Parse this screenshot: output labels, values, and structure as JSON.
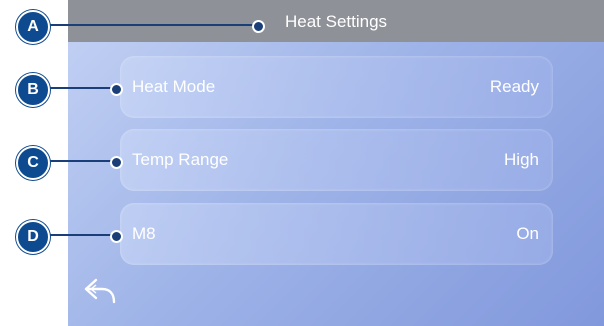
{
  "screen": {
    "title": "Heat Settings",
    "rows": [
      {
        "label": "Heat Mode",
        "value": "Ready"
      },
      {
        "label": "Temp Range",
        "value": "High"
      },
      {
        "label": "M8",
        "value": "On"
      }
    ],
    "back_icon": "back-arrow-icon"
  },
  "callouts": [
    "A",
    "B",
    "C",
    "D"
  ],
  "colors": {
    "titlebar": "#8f9199",
    "screen_light": "#c4d2f4",
    "screen_dark": "#8198dc",
    "callout": "#0e4a8f",
    "text": "#ffffff"
  }
}
